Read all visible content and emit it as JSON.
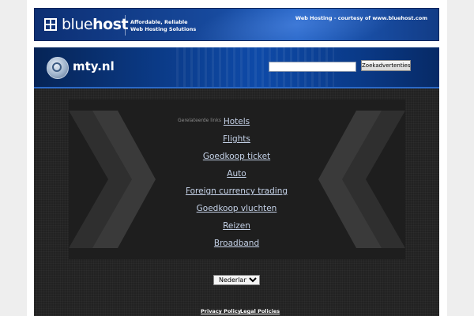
{
  "bluehost_banner": {
    "logo_text_regular": "blue",
    "logo_text_bold": "host",
    "tagline_line1": "Affordable, Reliable",
    "tagline_line2": "Web Hosting Solutions",
    "courtesy": "Web Hosting - courtesy of www.bluehost.com"
  },
  "header": {
    "site_name": "mty.nl",
    "search_value": "",
    "search_button": "Zoekadvertenties"
  },
  "main": {
    "related_label": "Gerelateerde links",
    "links": [
      "Hotels",
      "Flights",
      "Goedkoop ticket",
      "Auto",
      "Foreign currency trading",
      "Goedkoop vluchten",
      "Reizen",
      "Broadband"
    ],
    "language_selected": "Nederlands"
  },
  "footer": {
    "privacy_policy": "Privacy Policy",
    "legal_policies": "Legal Policies"
  },
  "colors": {
    "banner_blue": "#174a9e",
    "main_bg": "#222222",
    "link": "#c5d2e8"
  }
}
